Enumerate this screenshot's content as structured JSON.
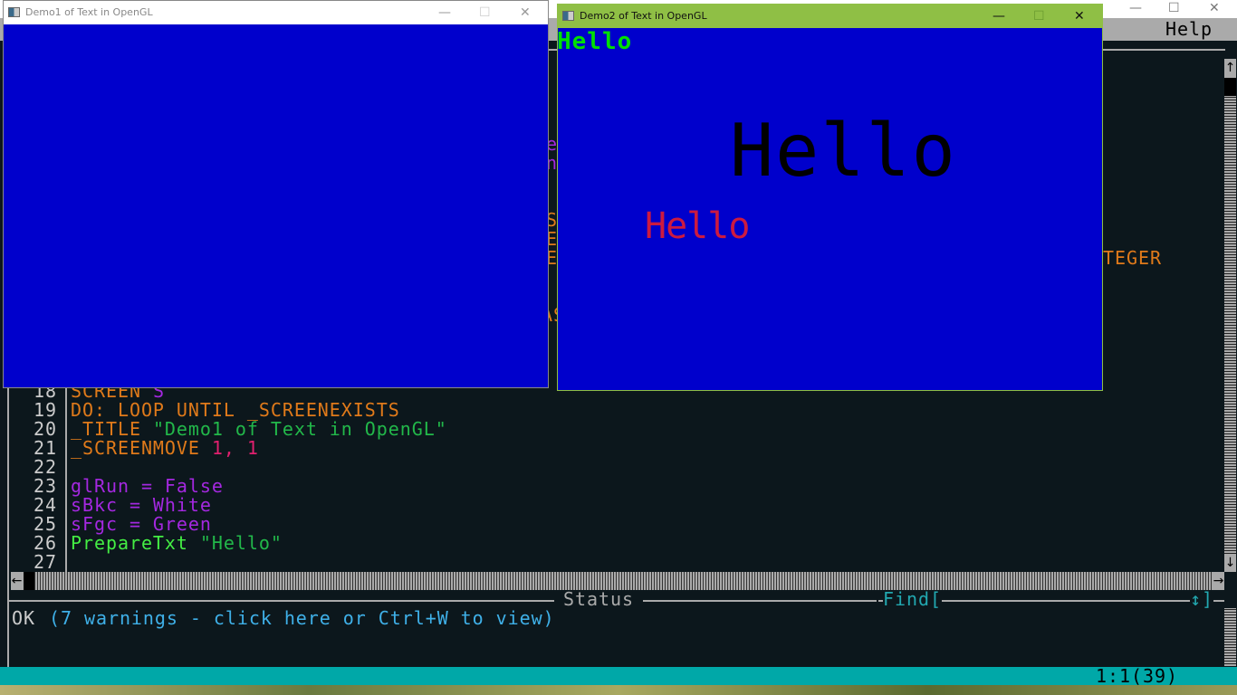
{
  "ide": {
    "menu": {
      "help": "Help"
    },
    "window_controls": {
      "minimize": "—",
      "maximize": "☐",
      "close": "✕"
    },
    "hidden_fragments": {
      "f1": "e",
      "f2": "n",
      "f3": "S",
      "f4": "E",
      "f5": "E(",
      "f6": "AS",
      "f7": "TEGER"
    },
    "code_lines": [
      {
        "num": "18",
        "text": "SCREEN S"
      },
      {
        "num": "19",
        "text": "DO: LOOP UNTIL _SCREENEXISTS"
      },
      {
        "num": "20",
        "text": "_TITLE \"Demo1 of Text in OpenGL\""
      },
      {
        "num": "21",
        "text": "_SCREENMOVE 1, 1"
      },
      {
        "num": "22",
        "text": ""
      },
      {
        "num": "23",
        "text": "glRun = False"
      },
      {
        "num": "24",
        "text": "sBkc = White"
      },
      {
        "num": "25",
        "text": "sFgc = Green"
      },
      {
        "num": "26",
        "text": "PrepareTxt \"Hello\""
      },
      {
        "num": "27",
        "text": ""
      }
    ],
    "tokens": {
      "l18a": "SCREEN ",
      "l18b": "S",
      "l19": "DO: LOOP UNTIL _SCREENEXISTS",
      "l20a": "_TITLE ",
      "l20b": "\"Demo1 of Text in OpenGL\"",
      "l21a": "_SCREENMOVE ",
      "l21b": "1, 1",
      "l23": "glRun = False",
      "l24": "sBkc = White",
      "l25": "sFgc = Green",
      "l26a": "PrepareTxt ",
      "l26b": "\"Hello\""
    },
    "status_label": "Status",
    "find_label": "Find[",
    "find_end": "↕]",
    "status_ok": "OK",
    "status_warnings": "(7 warnings - click here or Ctrl+W to view)",
    "cursor_position": "1:1(39)",
    "scroll_arrows": {
      "up": "↑",
      "down": "↓",
      "left": "←",
      "right": "→"
    }
  },
  "demo1": {
    "title": "Demo1 of Text in OpenGL",
    "background": "#0000cc"
  },
  "demo2": {
    "title": "Demo2 of Text in OpenGL",
    "titlebar_color": "#8fbf45",
    "hello_small": "Hello",
    "hello_large": "Hello",
    "hello_red": "Hello"
  }
}
